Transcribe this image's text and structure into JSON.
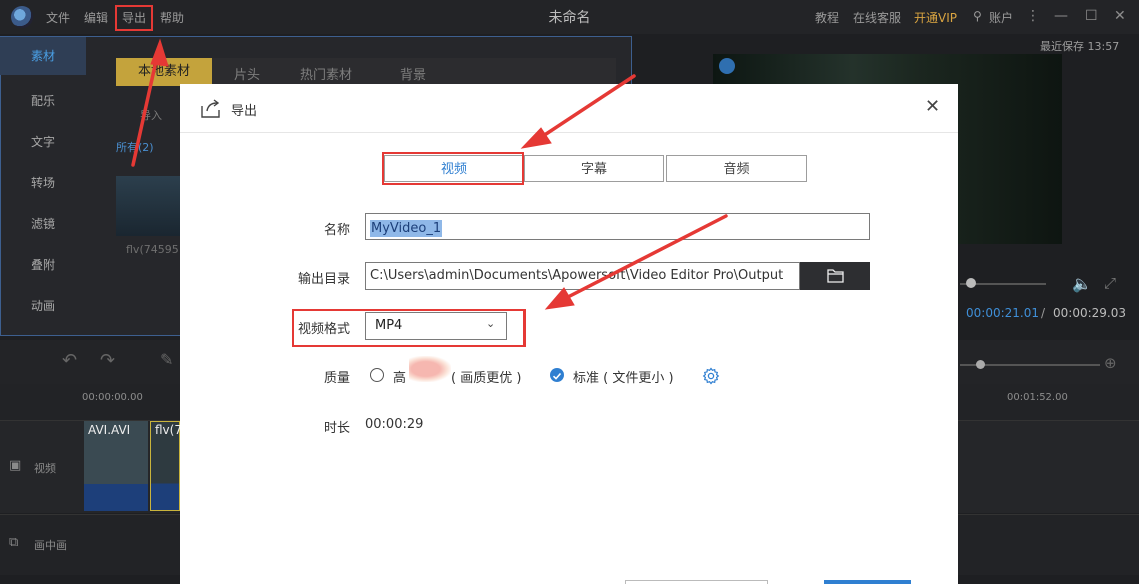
{
  "titlebar": {
    "menu": [
      {
        "label": "文件"
      },
      {
        "label": "编辑"
      },
      {
        "label": "导出"
      },
      {
        "label": "帮助"
      }
    ],
    "window_title": "未命名",
    "links": {
      "tutorial": "教程",
      "support": "在线客服",
      "vip": "开通VIP",
      "account": "账户"
    }
  },
  "sidebar": {
    "items": [
      {
        "label": "素材"
      },
      {
        "label": "配乐"
      },
      {
        "label": "文字"
      },
      {
        "label": "转场"
      },
      {
        "label": "滤镜"
      },
      {
        "label": "叠附"
      },
      {
        "label": "动画"
      }
    ]
  },
  "content": {
    "tabs": [
      {
        "label": "本地素材"
      },
      {
        "label": "片头"
      },
      {
        "label": "热门素材"
      },
      {
        "label": "背景"
      }
    ],
    "import_label": "导入",
    "all_label": "所有(2)",
    "thumb_label": "flv(74595"
  },
  "preview": {
    "autosave": "最近保存 13:57",
    "time_current": "00:00:21.01",
    "time_separator": "/",
    "time_total": "00:00:29.03"
  },
  "timeline": {
    "ruler": [
      "00:00:00.00",
      "00:01:52.00"
    ],
    "tracks": [
      {
        "label": "视频"
      },
      {
        "label": "画中画"
      }
    ],
    "clips": [
      {
        "label": "AVI.AVI"
      },
      {
        "label": "flv(7"
      }
    ]
  },
  "dialog": {
    "title": "导出",
    "tabs": [
      {
        "label": "视频"
      },
      {
        "label": "字幕"
      },
      {
        "label": "音频"
      }
    ],
    "active_tab": "视频",
    "name_label": "名称",
    "name_value": "MyVideo_1",
    "dir_label": "输出目录",
    "dir_value": "C:\\Users\\admin\\Documents\\Apowersoft\\Video Editor Pro\\Output",
    "format_label": "视频格式",
    "format_value": "MP4",
    "quality_label": "质量",
    "quality_high": "高",
    "quality_high_note": "( 画质更优 )",
    "quality_standard": "标准 ( 文件更小 )",
    "quality_selected": "standard",
    "duration_label": "时长",
    "duration_value": "00:00:29"
  },
  "colors": {
    "accent": "#2f7fd1",
    "annotation_red": "#e53935",
    "dark_bg": "#1e1f22",
    "local_tab_gold": "#c4a33c"
  }
}
